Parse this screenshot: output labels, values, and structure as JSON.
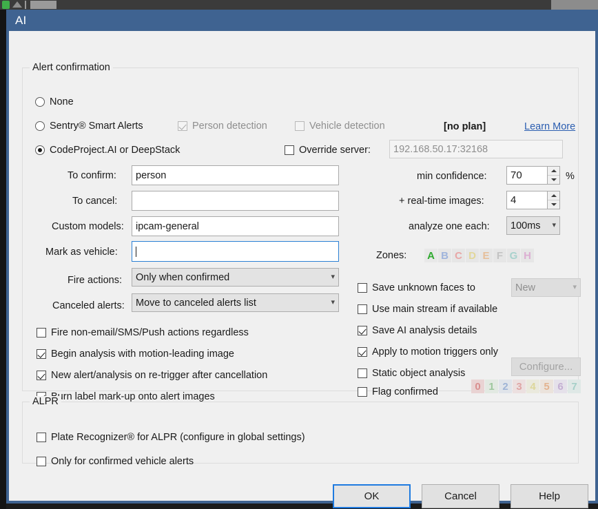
{
  "window": {
    "title": "AI"
  },
  "alert_group": {
    "legend": "Alert confirmation",
    "mode_none": "None",
    "mode_sentry": "Sentry® Smart Alerts",
    "mode_codeproject": "CodeProject.AI or DeepStack",
    "person_detection": "Person detection",
    "vehicle_detection": "Vehicle detection",
    "no_plan": "[no plan]",
    "learn_more": "Learn More",
    "override_server": "Override server:",
    "server_value": "192.168.50.17:32168"
  },
  "fields": {
    "to_confirm_label": "To confirm:",
    "to_confirm_value": "person",
    "to_cancel_label": "To cancel:",
    "to_cancel_value": "",
    "custom_models_label": "Custom models:",
    "custom_models_value": "ipcam-general",
    "mark_as_vehicle_label": "Mark as vehicle:",
    "mark_as_vehicle_value": "",
    "fire_actions_label": "Fire actions:",
    "fire_actions_value": "Only when confirmed",
    "canceled_alerts_label": "Canceled alerts:",
    "canceled_alerts_value": "Move to canceled alerts list"
  },
  "right_controls": {
    "min_confidence_label": "min confidence:",
    "min_confidence_value": "70",
    "percent_sign": "%",
    "realtime_images_label": "+ real-time images:",
    "realtime_images_value": "4",
    "analyze_one_each_label": "analyze one each:",
    "analyze_one_each_value": "100ms",
    "zones_label": "Zones:",
    "zones": [
      {
        "letter": "A",
        "color": "#2faa2f",
        "active": true
      },
      {
        "letter": "B",
        "color": "#9fb4dc",
        "active": false
      },
      {
        "letter": "C",
        "color": "#e8a7a7",
        "active": false
      },
      {
        "letter": "D",
        "color": "#e2d79a",
        "active": false
      },
      {
        "letter": "E",
        "color": "#e6bf9a",
        "active": false
      },
      {
        "letter": "F",
        "color": "#c3c3c3",
        "active": false
      },
      {
        "letter": "G",
        "color": "#a8d2cd",
        "active": false
      },
      {
        "letter": "H",
        "color": "#dcaed2",
        "active": false
      }
    ],
    "save_unknown_faces": "Save unknown faces to",
    "save_unknown_faces_target": "New",
    "use_main_stream": "Use main stream if available",
    "save_ai_details": "Save AI analysis details",
    "apply_motion_triggers": "Apply to motion triggers only",
    "static_object_analysis": "Static object analysis",
    "configure_button": "Configure...",
    "flag_confirmed": "Flag confirmed",
    "flags": [
      {
        "digit": "0",
        "color": "#d98f8f",
        "bg": "#e9d3d3"
      },
      {
        "digit": "1",
        "color": "#9ec79e",
        "bg": "#e2e9e2"
      },
      {
        "digit": "2",
        "color": "#9fb4d6",
        "bg": "#e0e4ea"
      },
      {
        "digit": "3",
        "color": "#dfa5a5",
        "bg": "#ece0e0"
      },
      {
        "digit": "4",
        "color": "#ddd79b",
        "bg": "#eae9dd"
      },
      {
        "digit": "5",
        "color": "#e3b390",
        "bg": "#ebe3dc"
      },
      {
        "digit": "6",
        "color": "#c3aed2",
        "bg": "#e5e1ea"
      },
      {
        "digit": "7",
        "color": "#a5cfc8",
        "bg": "#dfe8e6"
      }
    ]
  },
  "left_checkboxes": {
    "fire_non_email": "Fire non-email/SMS/Push actions regardless",
    "begin_analysis": "Begin analysis with motion-leading image",
    "new_alert_retrigger": "New alert/analysis on re-trigger after cancellation",
    "burn_label": "Burn label mark-up onto alert images"
  },
  "alpr_group": {
    "legend": "ALPR",
    "plate_recognizer": "Plate Recognizer® for ALPR (configure in global settings)",
    "only_confirmed_vehicle": "Only for confirmed vehicle alerts"
  },
  "buttons": {
    "ok": "OK",
    "cancel": "Cancel",
    "help": "Help"
  },
  "colors": {
    "title_bar": "#3f6391",
    "accent_focus": "#1e7ae0",
    "link": "#2a5db0",
    "client_bg": "#f0f0f0"
  }
}
